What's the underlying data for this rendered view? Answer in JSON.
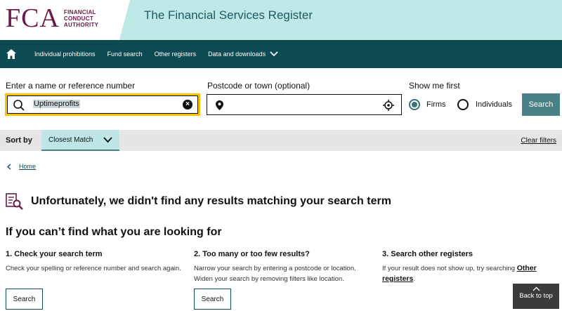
{
  "header": {
    "logo_letters": "FCA",
    "logo_line1": "FINANCIAL",
    "logo_line2": "CONDUCT",
    "logo_line3": "AUTHORITY",
    "title": "The Financial Services Register"
  },
  "nav": {
    "home_icon": "home-icon",
    "items": [
      {
        "label": "Individual prohibitions"
      },
      {
        "label": "Fund search"
      },
      {
        "label": "Other registers"
      },
      {
        "label": "Data and downloads"
      }
    ]
  },
  "search": {
    "name_label": "Enter a name or reference number",
    "name_value": "Uptimeprofits",
    "postcode_label": "Postcode or town (optional)",
    "postcode_value": "",
    "show_first_label": "Show me first",
    "option_firms": "Firms",
    "option_individuals": "Individuals",
    "selected": "Firms",
    "button": "Search"
  },
  "sort": {
    "label": "Sort by",
    "selected": "Closest Match",
    "clear_filters": "Clear filters"
  },
  "breadcrumb": {
    "home": "Home"
  },
  "results": {
    "no_results_title": "Unfortunately, we didn't find any results matching your search term",
    "help_heading": "If you can’t find what you are looking for",
    "columns": [
      {
        "heading": "1. Check your search term",
        "text": "Check your spelling or reference number and search again.",
        "button": "Search"
      },
      {
        "heading": "2. Too many or too few results?",
        "text": "Narrow your search by entering a postcode or location. Widen your search by removing filters like location.",
        "button": "Search"
      },
      {
        "heading": "3. Search other registers",
        "text_before": "If your result does not show up, try searching ",
        "link": "Other registers",
        "text_after": "."
      }
    ]
  },
  "back_to_top": "Back to top",
  "colors": {
    "brand": "#6b1a48",
    "nav_bg": "#0d4a52",
    "header_band": "#bfe9e6",
    "focus": "#f7c300",
    "button": "#4a8187"
  }
}
